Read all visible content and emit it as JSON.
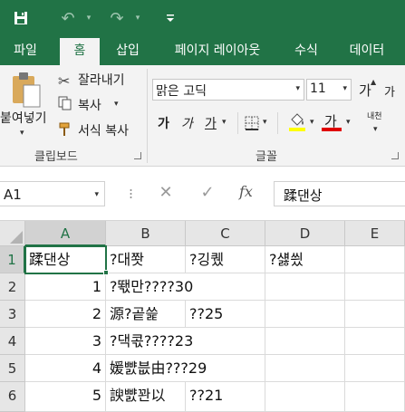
{
  "quick_access": {
    "save_icon": "save-icon",
    "undo_icon": "undo-icon",
    "redo_icon": "redo-icon",
    "customize_icon": "customize-quick-access-icon"
  },
  "tabs": [
    "파일",
    "홈",
    "삽입",
    "페이지 레이아웃",
    "수식",
    "데이터"
  ],
  "active_tab": "홈",
  "clipboard": {
    "paste_label": "붙여넣기",
    "cut_label": "잘라내기",
    "copy_label": "복사",
    "format_painter_label": "서식 복사",
    "group_label": "클립보드"
  },
  "font": {
    "font_name": "맑은 고딕",
    "font_size": "11",
    "grow_label": "가",
    "shrink_label": "가",
    "bold_label": "가",
    "italic_label": "가",
    "underline_label": "가",
    "font_color_label": "가",
    "phonetic_label": "내천",
    "group_label": "글꼴"
  },
  "formula_bar": {
    "name_box": "A1",
    "fx_label": "fx",
    "content": "蹂댄상"
  },
  "sheet": {
    "columns": [
      "A",
      "B",
      "C",
      "D",
      "E"
    ],
    "rows": [
      "1",
      "2",
      "3",
      "4",
      "5",
      "6"
    ],
    "row1": [
      "蹂댄상",
      "?대쫫",
      "?깅퀬",
      "?섏씠",
      ""
    ],
    "row2": [
      "1",
      "?뙋만????30",
      "",
      "",
      ""
    ],
    "row3": [
      "2",
      "源?곹쓽",
      "??25",
      "",
      ""
    ],
    "row4": [
      "3",
      "?댁콗????23",
      "",
      "",
      ""
    ],
    "row5": [
      "4",
      "媛뺤븞由???29",
      "",
      "",
      ""
    ],
    "row6": [
      "5",
      "諛뺤꽌以",
      "??21",
      "",
      ""
    ]
  },
  "colors": {
    "brand": "#217346",
    "font_color_underline": "#e00000"
  }
}
